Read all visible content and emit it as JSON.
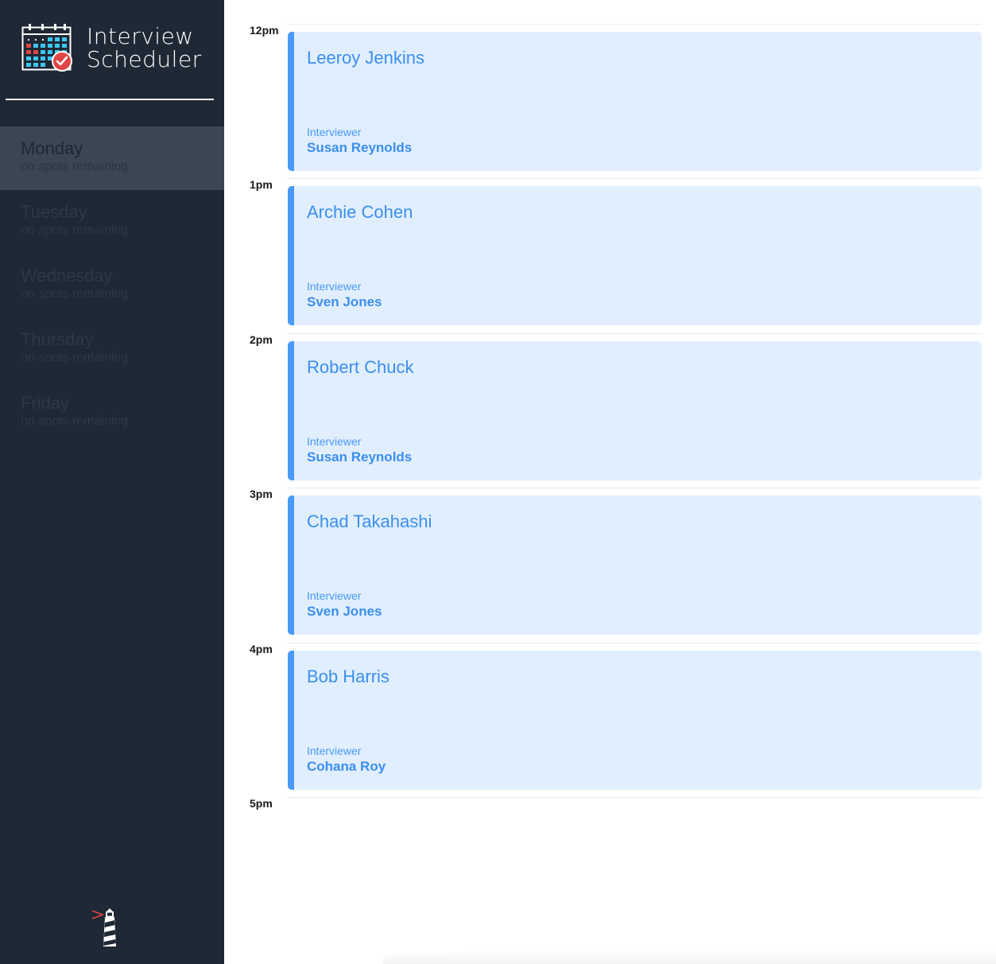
{
  "app": {
    "title_line1": "Interview",
    "title_line2": "Scheduler"
  },
  "colors": {
    "sidebar_bg": "#1f2835",
    "sidebar_selected": "#3b4553",
    "card_bg": "#e1eefd",
    "card_accent": "#4a9af7",
    "card_text": "#3b8ff0"
  },
  "days": [
    {
      "name": "Monday",
      "spots": "no spots remaining",
      "selected": true
    },
    {
      "name": "Tuesday",
      "spots": "no spots remaining",
      "selected": false
    },
    {
      "name": "Wednesday",
      "spots": "no spots remaining",
      "selected": false
    },
    {
      "name": "Thursday",
      "spots": "no spots remaining",
      "selected": false
    },
    {
      "name": "Friday",
      "spots": "no spots remaining",
      "selected": false
    }
  ],
  "appointments": [
    {
      "time": "12pm",
      "student": "Leeroy Jenkins",
      "interviewer_label": "Interviewer",
      "interviewer": "Susan Reynolds"
    },
    {
      "time": "1pm",
      "student": "Archie Cohen",
      "interviewer_label": "Interviewer",
      "interviewer": "Sven Jones"
    },
    {
      "time": "2pm",
      "student": "Robert Chuck",
      "interviewer_label": "Interviewer",
      "interviewer": "Susan Reynolds"
    },
    {
      "time": "3pm",
      "student": "Chad Takahashi",
      "interviewer_label": "Interviewer",
      "interviewer": "Sven Jones"
    },
    {
      "time": "4pm",
      "student": "Bob Harris",
      "interviewer_label": "Interviewer",
      "interviewer": "Cohana Roy"
    }
  ],
  "end_time": "5pm",
  "icons": {
    "brand": "calendar-check-icon",
    "footer": "lighthouse-icon"
  }
}
